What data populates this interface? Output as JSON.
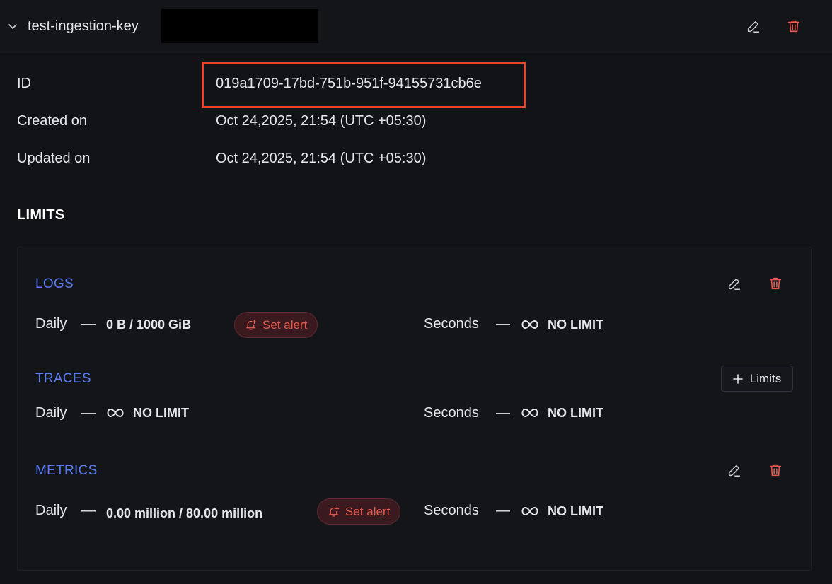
{
  "header": {
    "key_name": "test-ingestion-key"
  },
  "info": {
    "id_label": "ID",
    "id_value": "019a1709-17bd-751b-951f-94155731cb6e",
    "created_label": "Created on",
    "created_value": "Oct 24,2025, 21:54 (UTC +05:30)",
    "updated_label": "Updated on",
    "updated_value": "Oct 24,2025, 21:54 (UTC +05:30)"
  },
  "limits": {
    "title": "LIMITS",
    "logs": {
      "title": "LOGS",
      "daily_label": "Daily",
      "daily_value": "0 B / 1000 GiB",
      "set_alert": "Set alert",
      "seconds_label": "Seconds",
      "seconds_value": "NO LIMIT"
    },
    "traces": {
      "title": "TRACES",
      "daily_label": "Daily",
      "daily_value": "NO LIMIT",
      "seconds_label": "Seconds",
      "seconds_value": "NO LIMIT",
      "add_limits": "Limits"
    },
    "metrics": {
      "title": "METRICS",
      "daily_label": "Daily",
      "daily_value": "0.00 million / 80.00 million",
      "set_alert": "Set alert",
      "seconds_label": "Seconds",
      "seconds_value": "NO LIMIT"
    }
  },
  "colors": {
    "accent_blue": "#5b7cf0",
    "danger_red": "#e65b4f",
    "highlight_box": "#e8442c",
    "background": "#121317"
  },
  "icons": {
    "collapse": "chevron-down-icon",
    "edit": "pencil-icon",
    "delete": "trash-icon",
    "alert": "bell-plus-icon",
    "infinity": "infinity-icon",
    "add": "plus-icon"
  }
}
